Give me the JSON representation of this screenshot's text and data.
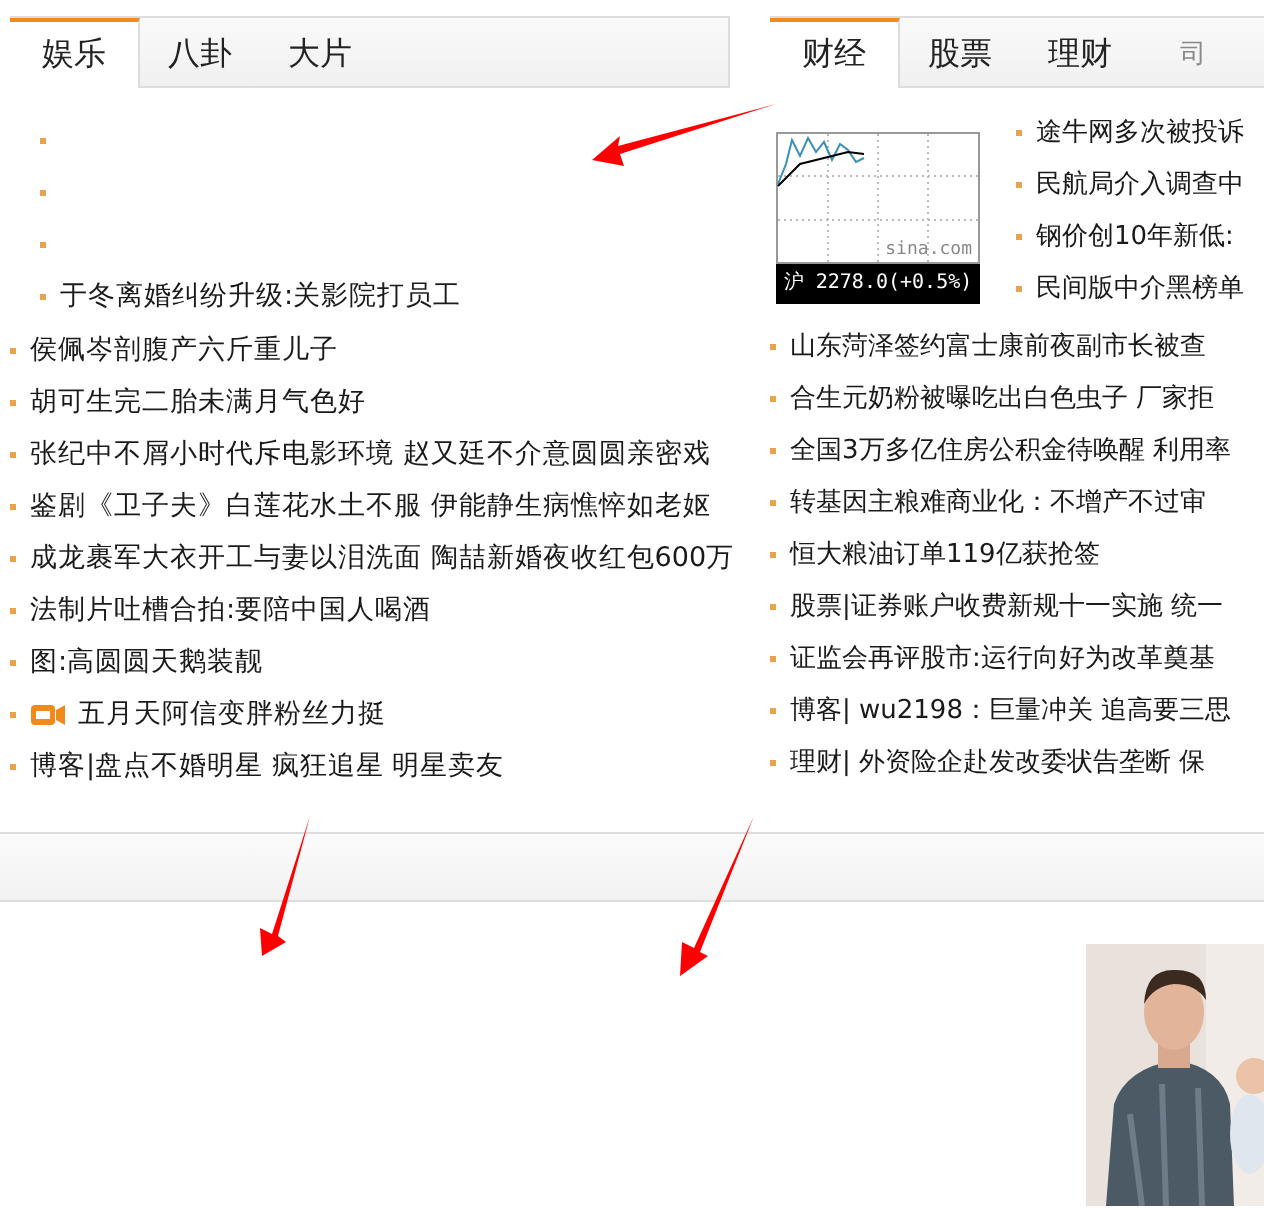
{
  "left": {
    "tabs": [
      {
        "label": "娱乐",
        "selected": true
      },
      {
        "label": "八卦",
        "selected": false
      },
      {
        "label": "大片",
        "selected": false
      }
    ],
    "lead": [
      {
        "kind": "blank"
      },
      {
        "kind": "blank"
      },
      {
        "kind": "blank"
      },
      {
        "kind": "text",
        "text": "于冬离婚纠纷升级:关影院打员工"
      }
    ],
    "items": [
      {
        "kind": "text",
        "text": "侯佩岑剖腹产六斤重儿子"
      },
      {
        "kind": "text",
        "text": "胡可生完二胎未满月气色好"
      },
      {
        "kind": "text",
        "text": "张纪中不屑小时代斥电影环境  赵又廷不介意圆圆亲密戏"
      },
      {
        "kind": "text",
        "text": "鉴剧《卫子夫》白莲花水土不服  伊能静生病憔悴如老妪"
      },
      {
        "kind": "text",
        "text": "成龙裹军大衣开工与妻以泪洗面  陶喆新婚夜收红包600万"
      },
      {
        "kind": "text",
        "text": "法制片吐槽合拍:要陪中国人喝酒"
      },
      {
        "kind": "text",
        "text": "图:高圆圆天鹅装靓"
      },
      {
        "kind": "video",
        "text": "五月天阿信变胖粉丝力挺"
      },
      {
        "kind": "text",
        "text": "博客|盘点不婚明星  疯狂追星  明星卖友"
      }
    ]
  },
  "right": {
    "tabs": [
      {
        "label": "财经",
        "selected": true
      },
      {
        "label": "股票",
        "selected": false
      },
      {
        "label": "理财",
        "selected": false
      },
      {
        "label": "司",
        "selected": false
      }
    ],
    "chart": {
      "source": "sina.com",
      "quote": "沪 2278.0(+0.5%)"
    },
    "lead": [
      "途牛网多次被投诉",
      "民航局介入调查中",
      "钢价创10年新低:",
      "民间版中介黑榜单"
    ],
    "items": [
      "山东菏泽签约富士康前夜副市长被查",
      "合生元奶粉被曝吃出白色虫子  厂家拒",
      "全国3万多亿住房公积金待唤醒  利用率",
      "转基因主粮难商业化：不增产不过审",
      "恒大粮油订单119亿获抢签",
      "股票|证券账户收费新规十一实施  统一",
      "证监会再评股市:运行向好为改革奠基",
      "博客|  wu2198：巨量冲关  追高要三思",
      "理财|  外资险企赴发改委状告垄断  保"
    ]
  }
}
